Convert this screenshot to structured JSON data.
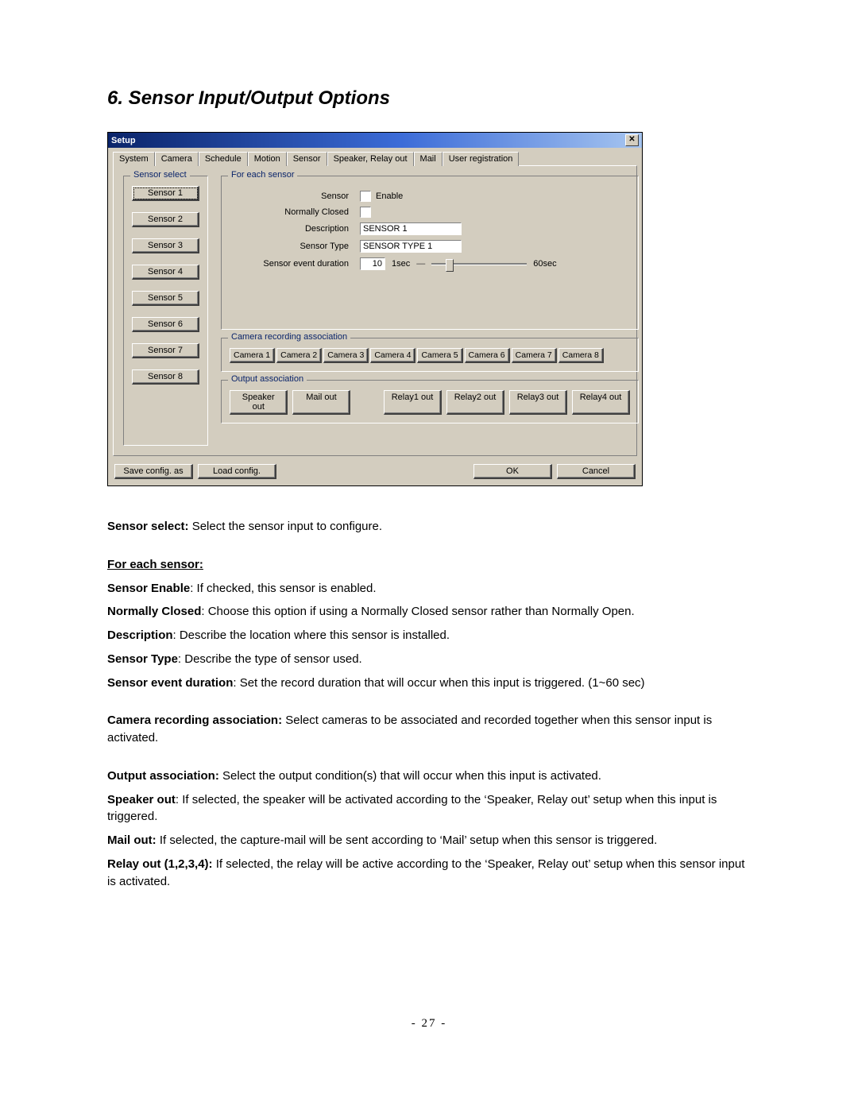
{
  "heading": "6. Sensor Input/Output Options",
  "dialog": {
    "title": "Setup",
    "tabs": [
      "System",
      "Camera",
      "Schedule",
      "Motion",
      "Sensor",
      "Speaker, Relay out",
      "Mail",
      "User registration"
    ],
    "active_tab_index": 4,
    "sensor_select": {
      "legend": "Sensor select",
      "buttons": [
        "Sensor 1",
        "Sensor 2",
        "Sensor 3",
        "Sensor 4",
        "Sensor 5",
        "Sensor 6",
        "Sensor 7",
        "Sensor 8"
      ],
      "selected_index": 0
    },
    "for_each": {
      "legend": "For each sensor",
      "labels": {
        "sensor": "Sensor",
        "enable": "Enable",
        "normally_closed": "Normally Closed",
        "description": "Description",
        "sensor_type": "Sensor Type",
        "duration": "Sensor event duration",
        "sec_min": "1sec",
        "sec_max": "60sec"
      },
      "values": {
        "enable_checked": false,
        "nc_checked": false,
        "description": "SENSOR 1",
        "sensor_type": "SENSOR TYPE 1",
        "duration": "10"
      }
    },
    "camera_assoc": {
      "legend": "Camera recording association",
      "buttons": [
        "Camera 1",
        "Camera 2",
        "Camera 3",
        "Camera 4",
        "Camera 5",
        "Camera 6",
        "Camera 7",
        "Camera 8"
      ]
    },
    "output_assoc": {
      "legend": "Output association",
      "buttons_left": [
        "Speaker out",
        "Mail out"
      ],
      "buttons_right": [
        "Relay1 out",
        "Relay2 out",
        "Relay3 out",
        "Relay4 out"
      ]
    },
    "bottom": {
      "save": "Save config. as",
      "load": "Load config.",
      "ok": "OK",
      "cancel": "Cancel"
    }
  },
  "body": {
    "p1_b": "Sensor select:",
    "p1": " Select the sensor input to configure.",
    "h_for_each": "For each sensor:",
    "p2_b": "Sensor Enable",
    "p2": ": If checked, this sensor is enabled.",
    "p3_b": "Normally Closed",
    "p3": ": Choose this option if using a Normally Closed sensor rather than Normally Open.",
    "p4_b": "Description",
    "p4": ": Describe the location where this sensor is installed.",
    "p5_b": "Sensor Type",
    "p5": ": Describe the type of sensor used.",
    "p6_b": "Sensor event duration",
    "p6": ": Set the record duration that will occur when this input is triggered. (1~60 sec)",
    "p7_b": "Camera recording association:",
    "p7": " Select cameras to be associated and recorded together when this sensor input is activated.",
    "p8_b": "Output association:",
    "p8": " Select the output condition(s) that will occur when this input is activated.",
    "p9_b": "Speaker out",
    "p9": ": If selected, the speaker will be activated according to the ‘Speaker, Relay out’ setup when this input is triggered.",
    "p10_b": "Mail out:",
    "p10": " If selected, the capture-mail will be sent according to ‘Mail’ setup when this sensor is triggered.",
    "p11_b": "Relay out (1,2,3,4):",
    "p11": " If selected, the relay will be active according to the ‘Speaker, Relay out’ setup when this sensor input is activated."
  },
  "page_number": "- 27 -"
}
